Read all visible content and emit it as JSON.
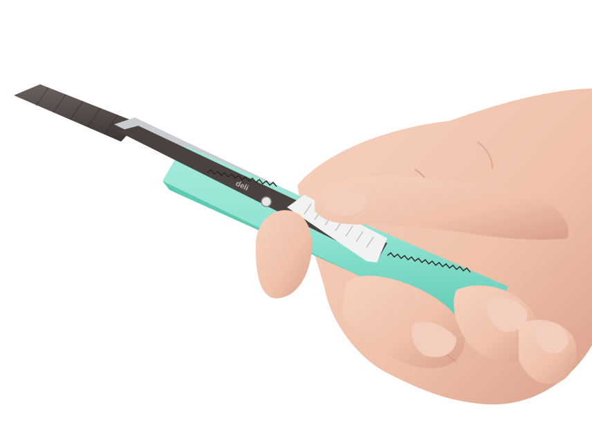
{
  "photo": {
    "subject": "hand-holding-utility-knife",
    "background_color": "#ffffff"
  },
  "knife": {
    "brand_label": "deli",
    "body_color": "#8fe3d2",
    "body_shadow_color": "#5fcab4",
    "blade_color": "#4a423f",
    "blade_highlight_color": "#6b625d",
    "metal_channel_color": "#c9ccd0",
    "slider_color": "#f2f2f2"
  },
  "hand": {
    "skin_color": "#f0c4ad",
    "skin_shadow_color": "#d9a38b",
    "nail_color": "#f3cdbd"
  }
}
